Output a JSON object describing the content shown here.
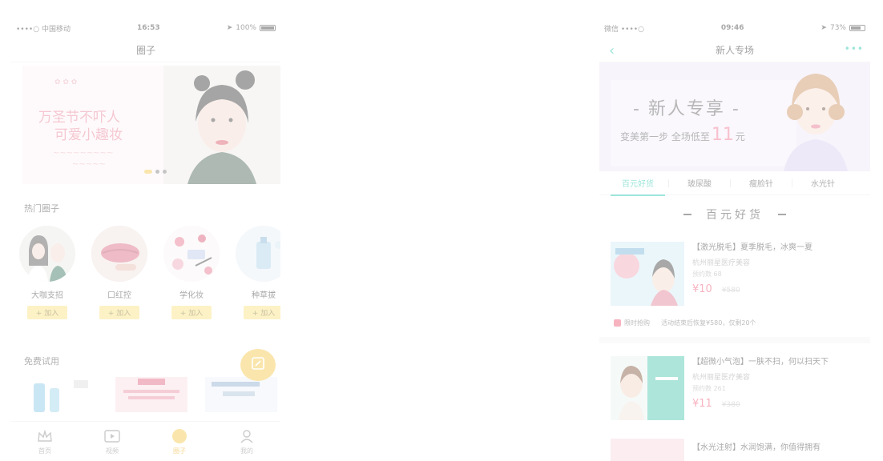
{
  "left_screen": {
    "status": {
      "carrier": "••••○ 中国移动",
      "time": "16:53",
      "battery": "100%",
      "battery_fraction": 1.0
    },
    "title": "圈子",
    "banner": {
      "line1": "万圣节不吓人",
      "line2": "可爱小趣妆",
      "carousel_active_index": 0,
      "carousel_count": 3
    },
    "hot_section_title": "热门圈子",
    "hot_circles": [
      {
        "name": "大咖支招",
        "join_label": "+ 加入"
      },
      {
        "name": "口红控",
        "join_label": "+ 加入"
      },
      {
        "name": "学化妆",
        "join_label": "+ 加入"
      },
      {
        "name": "种草拔",
        "join_label": "+ 加入"
      }
    ],
    "trial_section_title": "免费试用",
    "tabbar": [
      {
        "label": "首页",
        "icon": "crown-icon"
      },
      {
        "label": "视频",
        "icon": "video-icon"
      },
      {
        "label": "圈子",
        "icon": "circle-icon"
      },
      {
        "label": "我的",
        "icon": "user-icon"
      }
    ],
    "tabbar_active": 2
  },
  "right_screen": {
    "status": {
      "carrier": "微信 ••••○",
      "time": "09:46",
      "battery": "73%",
      "battery_fraction": 0.73
    },
    "title": "新人专场",
    "back_icon": "back-chevron-icon",
    "more_icon": "more-dots-icon",
    "banner": {
      "title": "- 新人专享 -",
      "subtitle_prefix": "变美第一步 全场低至",
      "subtitle_number": "11",
      "subtitle_suffix": "元"
    },
    "tabs": [
      "百元好货",
      "玻尿酸",
      "瘦脸针",
      "水光针"
    ],
    "active_tab": 0,
    "section_title": "百元好货",
    "products": [
      {
        "title": "【激光脱毛】夏季脱毛，冰爽一夏",
        "hospital": "杭州丽星医疗美容",
        "sold": "预约数 68",
        "price": "¥10",
        "old_price": "¥580"
      },
      {
        "title": "【超微小气泡】一肤不扫，何以扫天下",
        "hospital": "杭州丽星医疗美容",
        "sold": "预约数 261",
        "price": "¥11",
        "old_price": "¥380"
      }
    ],
    "promo": {
      "tag": "限时抢购",
      "text": "活动结束后恢复¥580，仅剩20个"
    },
    "third_product_title": "【水光注射】水润饱满，你值得拥有"
  }
}
